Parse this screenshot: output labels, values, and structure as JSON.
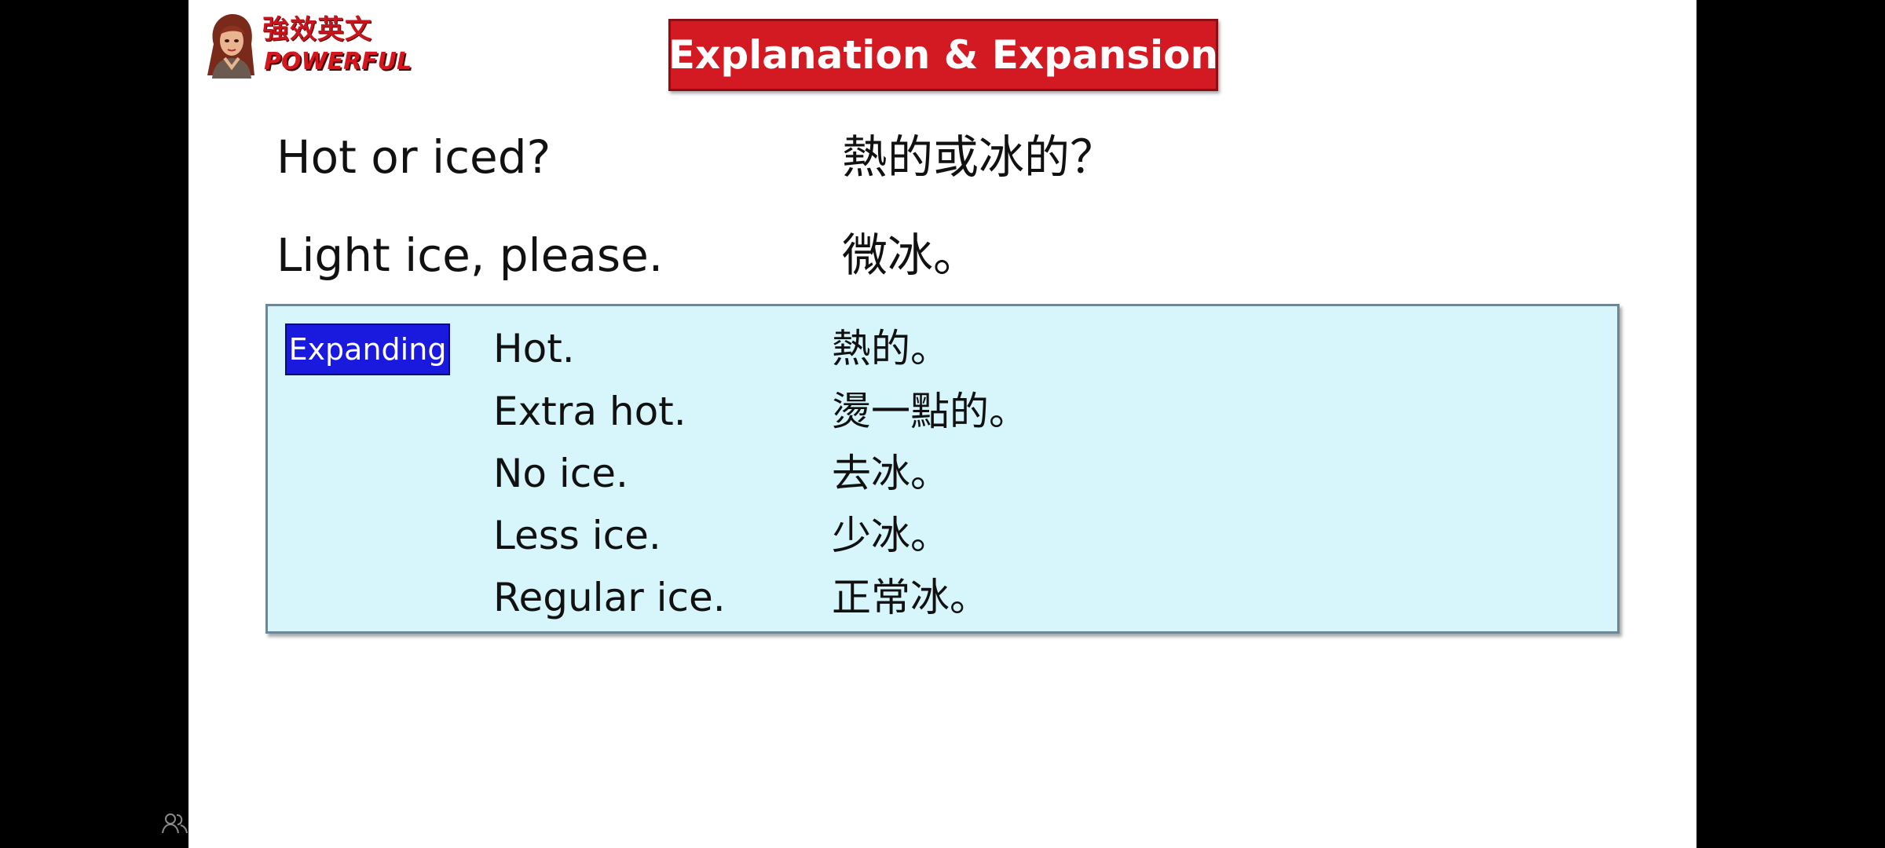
{
  "logo": {
    "chinese_text": "強效英文",
    "english_text": "POWERFUL"
  },
  "title": "Explanation & Expansion",
  "phrases": [
    {
      "en": "Hot or iced?",
      "zh": "熱的或冰的？"
    },
    {
      "en": "Light ice, please.",
      "zh": "微冰。"
    }
  ],
  "expanding": {
    "badge_label": "Expanding",
    "items": [
      {
        "en": "Hot.",
        "zh": "熱的。"
      },
      {
        "en": "Extra hot.",
        "zh": "燙一點的。"
      },
      {
        "en": "No ice.",
        "zh": "去冰。"
      },
      {
        "en": "Less ice.",
        "zh": "少冰。"
      },
      {
        "en": "Regular ice.",
        "zh": "正常冰。"
      }
    ]
  },
  "colors": {
    "title_banner": "#d31a23",
    "panel_background": "#d6f6fb",
    "badge_background": "#1a1adf",
    "logo_text": "#c8141c"
  },
  "icons": {
    "bottom_left": "people-icon"
  }
}
